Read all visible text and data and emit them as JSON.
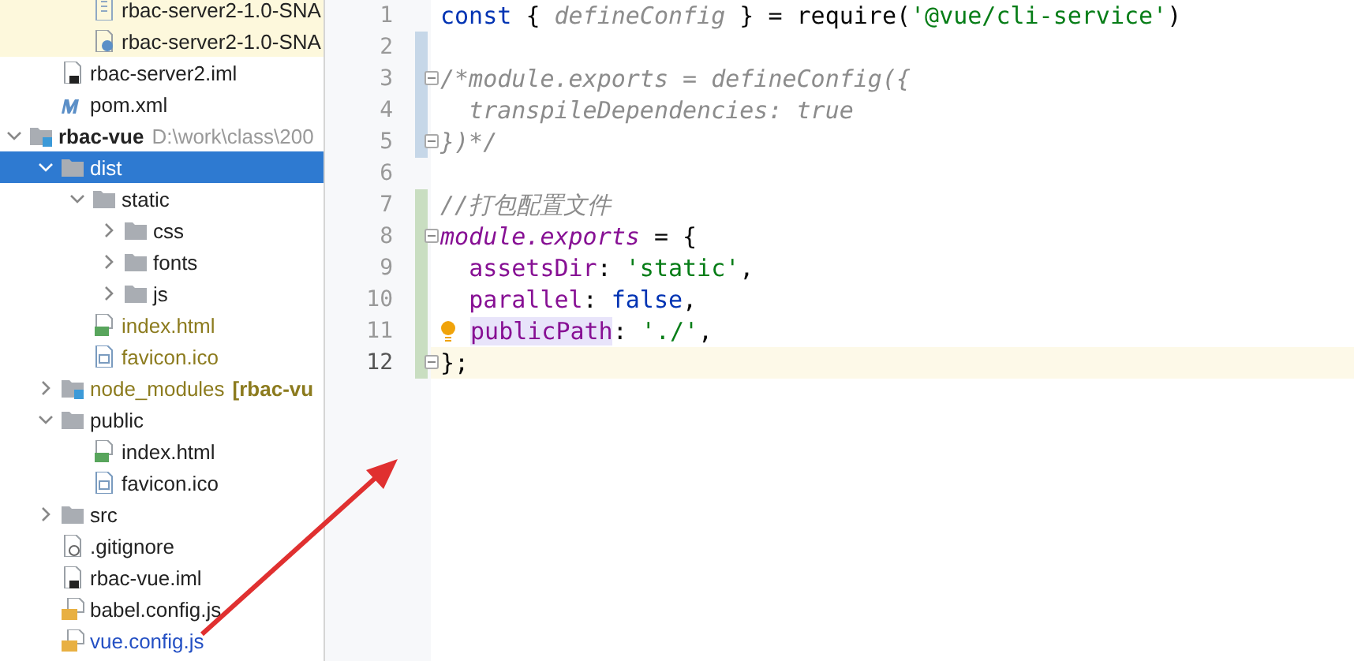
{
  "project_tree": {
    "items": [
      {
        "children": [
          {
            "name": "rbac-server2-1.0-SNA",
            "kind": "archive",
            "color": "#222222",
            "ignored": true,
            "selected": false
          },
          {
            "name": "rbac-server2-1.0-SNA",
            "kind": "unknown",
            "color": "#222222",
            "ignored": true,
            "selected": false
          }
        ]
      },
      {
        "name": "rbac-server2.iml",
        "kind": "iml",
        "color": "#222222",
        "ignored": false,
        "selected": false
      },
      {
        "name": "pom.xml",
        "kind": "maven",
        "color": "#222222",
        "ignored": false,
        "selected": false
      }
    ]
  },
  "tree": [
    {
      "name": "rbac-vue",
      "kind": "module",
      "color": "#222222",
      "bold": true,
      "path": "D:\\work\\class\\200",
      "expanded": true,
      "selected": false,
      "children": [
        {
          "name": "dist",
          "kind": "folder",
          "color": "#ffffff",
          "expanded": true,
          "selected": true,
          "children": [
            {
              "name": "static",
              "kind": "folder",
              "color": "#222222",
              "expanded": true,
              "selected": false,
              "children": [
                {
                  "name": "css",
                  "kind": "folder",
                  "color": "#222222",
                  "expanded": false,
                  "selected": false
                },
                {
                  "name": "fonts",
                  "kind": "folder",
                  "color": "#222222",
                  "expanded": false,
                  "selected": false
                },
                {
                  "name": "js",
                  "kind": "folder",
                  "color": "#222222",
                  "expanded": false,
                  "selected": false
                }
              ]
            },
            {
              "name": "index.html",
              "kind": "html",
              "color": "#8c7b1e",
              "selected": false
            },
            {
              "name": "favicon.ico",
              "kind": "ico",
              "color": "#8c7b1e",
              "selected": false
            }
          ]
        },
        {
          "name": "node_modules",
          "kind": "module",
          "color": "#8c7b1e",
          "module": "[rbac-vu",
          "expanded": false,
          "selected": false
        },
        {
          "name": "public",
          "kind": "folder",
          "color": "#222222",
          "expanded": true,
          "selected": false,
          "children": [
            {
              "name": "index.html",
              "kind": "html",
              "color": "#222222",
              "selected": false
            },
            {
              "name": "favicon.ico",
              "kind": "ico",
              "color": "#222222",
              "selected": false
            }
          ]
        },
        {
          "name": "src",
          "kind": "folder",
          "color": "#222222",
          "expanded": false,
          "selected": false
        },
        {
          "name": ".gitignore",
          "kind": "gitignore",
          "color": "#222222",
          "selected": false
        },
        {
          "name": "rbac-vue.iml",
          "kind": "iml",
          "color": "#222222",
          "selected": false
        },
        {
          "name": "babel.config.js",
          "kind": "js",
          "color": "#222222",
          "selected": false
        },
        {
          "name": "vue.config.js",
          "kind": "js",
          "color": "#2450c4",
          "selected": false
        }
      ]
    }
  ],
  "editor": {
    "lines": [
      {
        "number": "1",
        "fold": false,
        "current": false,
        "tokens": [
          {
            "text": "const",
            "kind": "keyword"
          },
          {
            "text": " { ",
            "kind": "plain"
          },
          {
            "text": "defineConfig",
            "kind": "param"
          },
          {
            "text": " } = require(",
            "kind": "plain"
          },
          {
            "text": "'@vue/cli-service'",
            "kind": "string"
          },
          {
            "text": ")",
            "kind": "plain"
          }
        ]
      },
      {
        "number": "2",
        "color": "#c6d7e8",
        "fold": false,
        "current": false
      },
      {
        "number": "3",
        "color": "#c6d7e8",
        "fold": true,
        "current": false,
        "tokens": [
          {
            "text": "/*module.exports = defineConfig({",
            "kind": "comment"
          }
        ]
      },
      {
        "number": "4",
        "color": "#c6d7e8",
        "fold": false,
        "current": false,
        "tokens": [
          {
            "text": "  transpileDependencies: true",
            "kind": "comment"
          }
        ]
      },
      {
        "number": "5",
        "color": "#c6d7e8",
        "fold": true,
        "current": false,
        "tokens": [
          {
            "text": "})*/",
            "kind": "comment"
          }
        ]
      },
      {
        "number": "6",
        "fold": false,
        "current": false
      },
      {
        "number": "7",
        "color": "#c9dec1",
        "fold": false,
        "current": false,
        "tokens": [
          {
            "text": "//打包配置文件",
            "kind": "comment"
          }
        ]
      },
      {
        "number": "8",
        "color": "#c9dec1",
        "fold": true,
        "current": false,
        "tokens": [
          {
            "text": "module.exports",
            "kind": "global"
          },
          {
            "text": " = {",
            "kind": "plain"
          }
        ]
      },
      {
        "number": "9",
        "color": "#c9dec1",
        "fold": false,
        "current": false,
        "tokens": [
          {
            "text": "  assetsDir",
            "kind": "property"
          },
          {
            "text": ": ",
            "kind": "plain"
          },
          {
            "text": "'static'",
            "kind": "string"
          },
          {
            "text": ",",
            "kind": "plain"
          }
        ]
      },
      {
        "number": "10",
        "color": "#c9dec1",
        "fold": false,
        "current": false,
        "tokens": [
          {
            "text": "  parallel",
            "kind": "property"
          },
          {
            "text": ": ",
            "kind": "plain"
          },
          {
            "text": "false",
            "kind": "keyword"
          },
          {
            "text": ",",
            "kind": "plain"
          }
        ]
      },
      {
        "number": "11",
        "color": "#c9dec1",
        "fold": false,
        "current": false,
        "bulb": true,
        "tokens": [
          {
            "text": " publicPath",
            "kind": "highlighted"
          },
          {
            "text": ": ",
            "kind": "plain"
          },
          {
            "text": "'./'",
            "kind": "string"
          },
          {
            "text": ",",
            "kind": "plain"
          }
        ]
      },
      {
        "number": "12",
        "color": "#c9dec1",
        "fold": true,
        "current": true,
        "tokens": [
          {
            "text": "};",
            "kind": "plain"
          }
        ]
      }
    ]
  }
}
